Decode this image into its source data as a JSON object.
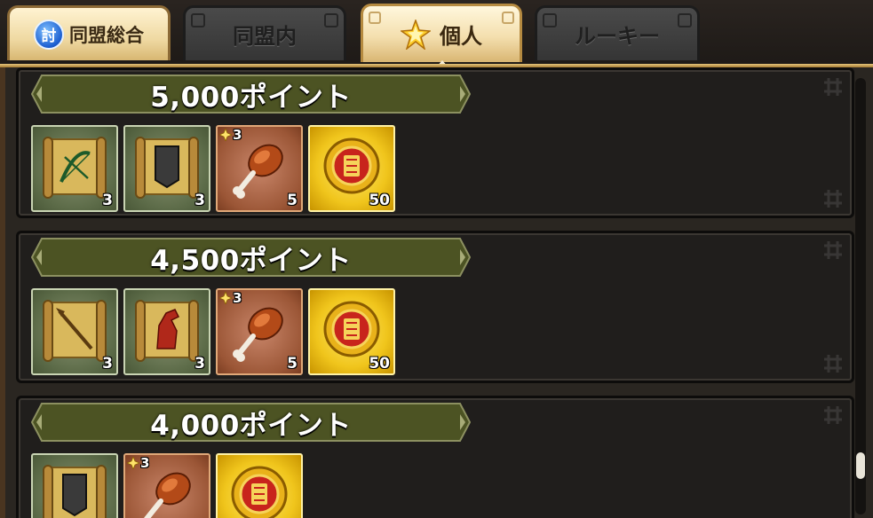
{
  "tabs": [
    {
      "label": "同盟総合",
      "icon_label": "討",
      "icon": "blue-flame-badge-icon",
      "state": "unselected"
    },
    {
      "label": "同盟内",
      "state": "disabled"
    },
    {
      "label": "個人",
      "icon": "sparkle-star-icon",
      "state": "selected"
    },
    {
      "label": "ルーキー",
      "state": "disabled"
    }
  ],
  "rewards": [
    {
      "points_label": "5,000ポイント",
      "items": [
        {
          "name": "bow-scroll",
          "icon": "bow-scroll-icon",
          "frame": "green",
          "qty": "3"
        },
        {
          "name": "armor-scroll",
          "icon": "armor-scroll-icon",
          "frame": "green",
          "qty": "3"
        },
        {
          "name": "meat",
          "icon": "meat-drumstick-icon",
          "frame": "bronze",
          "qty": "5",
          "star": "3"
        },
        {
          "name": "coin",
          "icon": "gold-coin-icon",
          "frame": "gold",
          "qty": "50"
        }
      ]
    },
    {
      "points_label": "4,500ポイント",
      "items": [
        {
          "name": "spear-scroll",
          "icon": "spear-scroll-icon",
          "frame": "green",
          "qty": "3"
        },
        {
          "name": "horse-scroll",
          "icon": "horse-scroll-icon",
          "frame": "green",
          "qty": "3"
        },
        {
          "name": "meat",
          "icon": "meat-drumstick-icon",
          "frame": "bronze",
          "qty": "5",
          "star": "3"
        },
        {
          "name": "coin",
          "icon": "gold-coin-icon",
          "frame": "gold",
          "qty": "50"
        }
      ]
    },
    {
      "points_label": "4,000ポイント",
      "items": [
        {
          "name": "armor-scroll",
          "icon": "armor-scroll-icon",
          "frame": "green",
          "qty": ""
        },
        {
          "name": "meat",
          "icon": "meat-drumstick-icon",
          "frame": "bronze",
          "qty": "",
          "star": "3"
        },
        {
          "name": "coin",
          "icon": "gold-coin-icon",
          "frame": "gold",
          "qty": ""
        }
      ]
    }
  ],
  "colors": {
    "banner_fill": "#4c5323",
    "banner_border": "#8c9060",
    "panel_bg": "#201e1c",
    "gold_accent": "#e8c67c"
  }
}
